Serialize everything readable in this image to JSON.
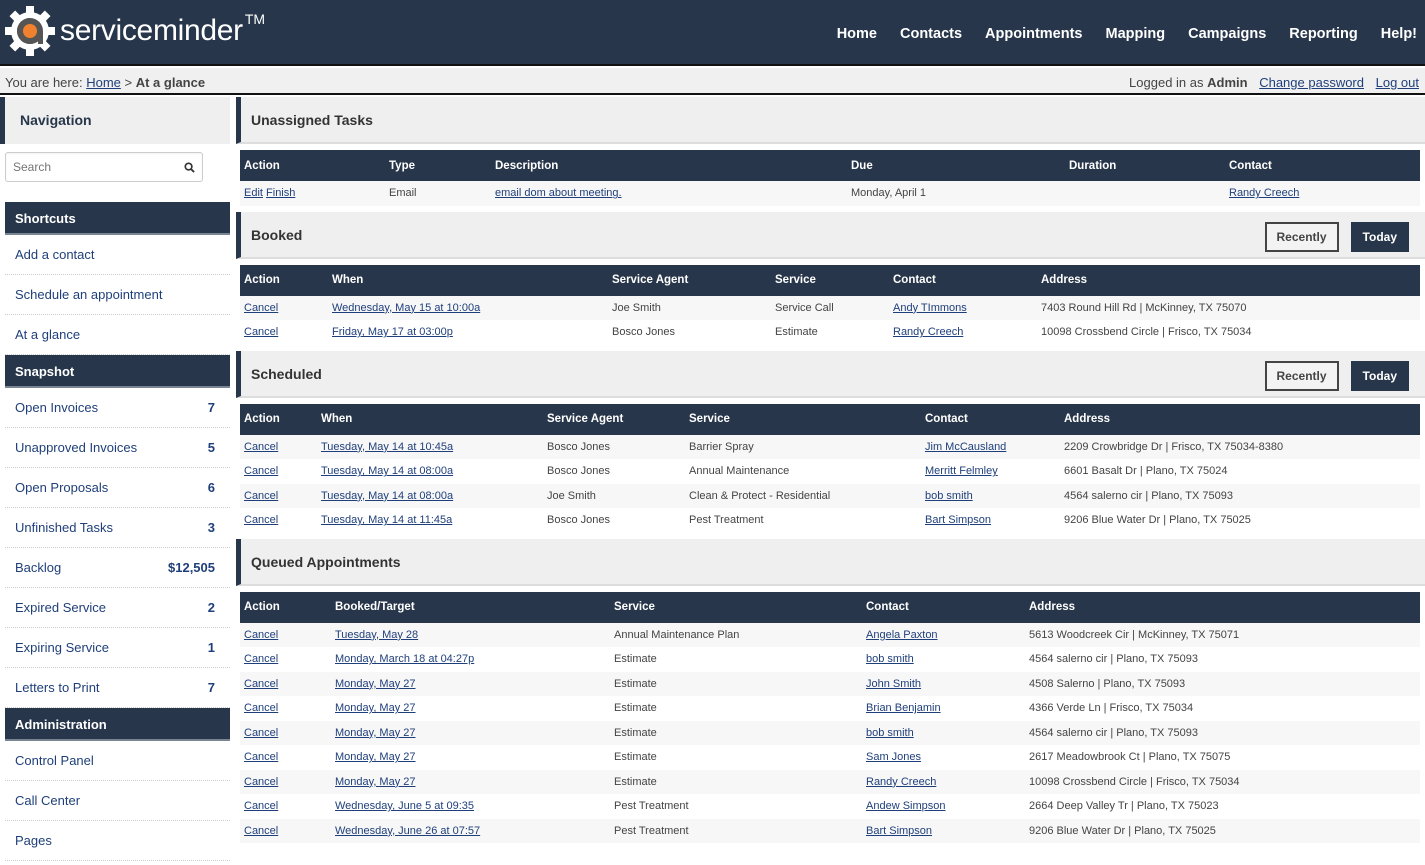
{
  "header": {
    "logo_light": "service",
    "logo_bold": "minder",
    "logo_tm": "TM",
    "nav": [
      "Home",
      "Contacts",
      "Appointments",
      "Mapping",
      "Campaigns",
      "Reporting",
      "Help!"
    ]
  },
  "breadcrumb": {
    "prefix": "You are here: ",
    "home": "Home",
    "sep": " > ",
    "current": "At a glance"
  },
  "login": {
    "prefix": "Logged in as ",
    "user": "Admin",
    "change_password": "Change password",
    "logout": "Log out"
  },
  "sidebar": {
    "title": "Navigation",
    "search_placeholder": "Search",
    "shortcuts_title": "Shortcuts",
    "shortcuts": [
      "Add a contact",
      "Schedule an appointment",
      "At a glance"
    ],
    "snapshot_title": "Snapshot",
    "snapshot": [
      {
        "label": "Open Invoices",
        "count": "7"
      },
      {
        "label": "Unapproved Invoices",
        "count": "5"
      },
      {
        "label": "Open Proposals",
        "count": "6"
      },
      {
        "label": "Unfinished Tasks",
        "count": "3"
      },
      {
        "label": "Backlog",
        "count": "$12,505"
      },
      {
        "label": "Expired Service",
        "count": "2"
      },
      {
        "label": "Expiring Service",
        "count": "1"
      },
      {
        "label": "Letters to Print",
        "count": "7"
      }
    ],
    "admin_title": "Administration",
    "admin": [
      "Control Panel",
      "Call Center",
      "Pages"
    ]
  },
  "buttons": {
    "recently": "Recently",
    "today": "Today"
  },
  "unassigned": {
    "title": "Unassigned Tasks",
    "columns": [
      "Action",
      "Type",
      "Description",
      "Due",
      "Duration",
      "Contact"
    ],
    "rows": [
      {
        "edit": "Edit",
        "finish": "Finish",
        "type": "Email",
        "description": "email dom about meeting.",
        "due": "Monday, April 1",
        "duration": "",
        "contact": "Randy Creech"
      }
    ]
  },
  "booked": {
    "title": "Booked",
    "columns": [
      "Action",
      "When",
      "Service Agent",
      "Service",
      "Contact",
      "Address"
    ],
    "rows": [
      {
        "action": "Cancel",
        "when": "Wednesday, May 15 at 10:00a",
        "agent": "Joe Smith",
        "service": "Service Call",
        "contact": "Andy TImmons",
        "address": "7403 Round Hill Rd | McKinney, TX 75070"
      },
      {
        "action": "Cancel",
        "when": "Friday, May 17 at 03:00p",
        "agent": "Bosco Jones",
        "service": "Estimate",
        "contact": "Randy Creech",
        "address": "10098 Crossbend Circle | Frisco, TX 75034"
      }
    ]
  },
  "scheduled": {
    "title": "Scheduled",
    "columns": [
      "Action",
      "When",
      "Service Agent",
      "Service",
      "Contact",
      "Address"
    ],
    "rows": [
      {
        "action": "Cancel",
        "when": "Tuesday, May 14 at 10:45a",
        "agent": "Bosco Jones",
        "service": "Barrier Spray",
        "contact": "Jim McCausland",
        "address": "2209 Crowbridge Dr | Frisco, TX 75034-8380"
      },
      {
        "action": "Cancel",
        "when": "Tuesday, May 14 at 08:00a",
        "agent": "Bosco Jones",
        "service": "Annual Maintenance",
        "contact": "Merritt Felmley",
        "address": "6601 Basalt Dr | Plano, TX 75024"
      },
      {
        "action": "Cancel",
        "when": "Tuesday, May 14 at 08:00a",
        "agent": "Joe Smith",
        "service": "Clean & Protect - Residential",
        "contact": "bob smith",
        "address": "4564 salerno cir | Plano, TX 75093"
      },
      {
        "action": "Cancel",
        "when": "Tuesday, May 14 at 11:45a",
        "agent": "Bosco Jones",
        "service": "Pest Treatment",
        "contact": "Bart Simpson",
        "address": "9206 Blue Water Dr | Plano, TX 75025"
      }
    ]
  },
  "queued": {
    "title": "Queued Appointments",
    "columns": [
      "Action",
      "Booked/Target",
      "Service",
      "Contact",
      "Address"
    ],
    "rows": [
      {
        "action": "Cancel",
        "when": "Tuesday, May 28",
        "service": "Annual Maintenance Plan",
        "contact": "Angela Paxton",
        "address": "5613 Woodcreek Cir | McKinney, TX 75071"
      },
      {
        "action": "Cancel",
        "when": "Monday, March 18 at 04:27p",
        "service": "Estimate",
        "contact": "bob smith",
        "address": "4564 salerno cir | Plano, TX 75093"
      },
      {
        "action": "Cancel",
        "when": "Monday, May 27",
        "service": "Estimate",
        "contact": "John Smith",
        "address": "4508 Salerno | Plano, TX 75093"
      },
      {
        "action": "Cancel",
        "when": "Monday, May 27",
        "service": "Estimate",
        "contact": "Brian Benjamin",
        "address": "4366 Verde Ln | Frisco, TX 75034"
      },
      {
        "action": "Cancel",
        "when": "Monday, May 27",
        "service": "Estimate",
        "contact": "bob smith",
        "address": "4564 salerno cir | Plano, TX 75093"
      },
      {
        "action": "Cancel",
        "when": "Monday, May 27",
        "service": "Estimate",
        "contact": "Sam Jones",
        "address": "2617 Meadowbrook Ct | Plano, TX 75075"
      },
      {
        "action": "Cancel",
        "when": "Monday, May 27",
        "service": "Estimate",
        "contact": "Randy Creech",
        "address": "10098 Crossbend Circle | Frisco, TX 75034"
      },
      {
        "action": "Cancel",
        "when": "Wednesday, June 5 at 09:35",
        "service": "Pest Treatment",
        "contact": "Andew Simpson",
        "address": "2664 Deep Valley Tr | Plano, TX 75023"
      },
      {
        "action": "Cancel",
        "when": "Wednesday, June 26 at 07:57",
        "service": "Pest Treatment",
        "contact": "Bart Simpson",
        "address": "9206 Blue Water Dr | Plano, TX 75025"
      }
    ]
  }
}
